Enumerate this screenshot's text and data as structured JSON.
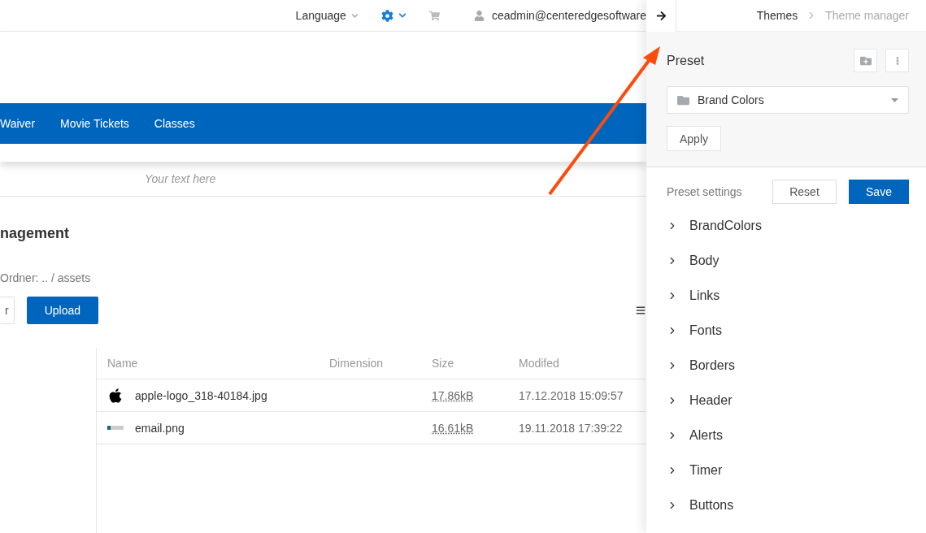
{
  "top_bar": {
    "language": "Language",
    "user_email": "ceadmin@centeredgesoftware"
  },
  "nav": {
    "items": [
      {
        "label": "Waiver"
      },
      {
        "label": "Movie Tickets"
      },
      {
        "label": "Classes"
      }
    ]
  },
  "text_placeholder": "Your text here",
  "page": {
    "title": "nagement",
    "folder_path": "Ordner: .. / assets",
    "buttons": [
      {
        "label": "r",
        "kind": "secondary"
      },
      {
        "label": "Upload",
        "kind": "primary"
      }
    ]
  },
  "table": {
    "columns": [
      "Name",
      "Dimension",
      "Size",
      "Modifed"
    ],
    "rows": [
      {
        "kind": "apple",
        "name": "apple-logo_318-40184.jpg",
        "size": "17.86kB",
        "modified": "17.12.2018 15:09:57"
      },
      {
        "kind": "email",
        "name": "email.png",
        "size": "16.61kB",
        "modified": "19.11.2018 17:39:22"
      }
    ]
  },
  "panel": {
    "breadcrumb": [
      {
        "label": "Themes",
        "selected": false
      },
      {
        "label": "Theme manager",
        "selected": true
      }
    ],
    "preset": {
      "title": "Preset",
      "value": "Brand Colors",
      "apply": "Apply"
    },
    "settings": {
      "title": "Preset settings",
      "reset": "Reset",
      "save": "Save",
      "sections": [
        {
          "label": "BrandColors",
          "expanded": false
        },
        {
          "label": "Body",
          "expanded": false
        },
        {
          "label": "Links",
          "expanded": false
        },
        {
          "label": "Fonts",
          "expanded": false
        },
        {
          "label": "Borders",
          "expanded": false
        },
        {
          "label": "Header",
          "expanded": false
        },
        {
          "label": "Alerts",
          "expanded": false
        },
        {
          "label": "Timer",
          "expanded": false
        },
        {
          "label": "Buttons",
          "expanded": false
        }
      ]
    }
  }
}
